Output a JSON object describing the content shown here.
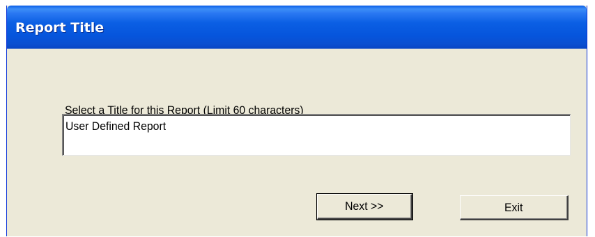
{
  "window": {
    "title": "Report Title"
  },
  "form": {
    "prompt_label": "Select a Title for this Report (Limit 60 characters)",
    "title_value": "User Defined Report"
  },
  "buttons": {
    "next_label": "Next >>",
    "exit_label": "Exit"
  },
  "colors": {
    "titlebar": "#0655dc",
    "window_background": "#ece9d8",
    "title_text": "#ffffff"
  }
}
